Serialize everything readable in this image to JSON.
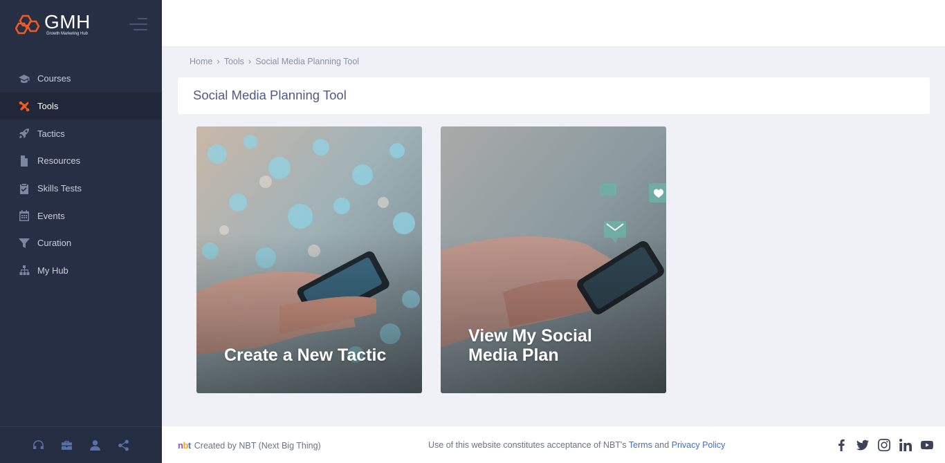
{
  "brand": {
    "name": "GMH",
    "subtitle": "Growth Marketing Hub"
  },
  "sidebar": {
    "items": [
      {
        "label": "Courses",
        "icon": "graduation-cap-icon",
        "active": false
      },
      {
        "label": "Tools",
        "icon": "tools-icon",
        "active": true
      },
      {
        "label": "Tactics",
        "icon": "rocket-icon",
        "active": false
      },
      {
        "label": "Resources",
        "icon": "document-icon",
        "active": false
      },
      {
        "label": "Skills Tests",
        "icon": "clipboard-check-icon",
        "active": false
      },
      {
        "label": "Events",
        "icon": "calendar-icon",
        "active": false
      },
      {
        "label": "Curation",
        "icon": "filter-icon",
        "active": false
      },
      {
        "label": "My Hub",
        "icon": "sitemap-icon",
        "active": false
      }
    ],
    "bottom_icons": [
      "headset-icon",
      "briefcase-icon",
      "user-icon",
      "share-icon"
    ]
  },
  "breadcrumb": {
    "home": "Home",
    "tools": "Tools",
    "current": "Social Media Planning Tool"
  },
  "page": {
    "title": "Social Media Planning Tool"
  },
  "cards": [
    {
      "label": "Create a New Tactic"
    },
    {
      "label": "View My Social Media Plan"
    }
  ],
  "footer": {
    "logo": "nbt",
    "created_by": "Created by  NBT (Next Big Thing)",
    "legal_prefix": "Use of this website constitutes acceptance of NBT's ",
    "terms": "Terms",
    "and": " and ",
    "privacy": "Privacy Policy",
    "social": [
      "facebook-icon",
      "twitter-icon",
      "instagram-icon",
      "linkedin-icon",
      "youtube-icon"
    ]
  },
  "colors": {
    "sidebar": "#262f44",
    "accent": "#f15a24",
    "title": "#4f5a84",
    "link": "#3f6fd6",
    "page_bg": "#eff1f7"
  }
}
